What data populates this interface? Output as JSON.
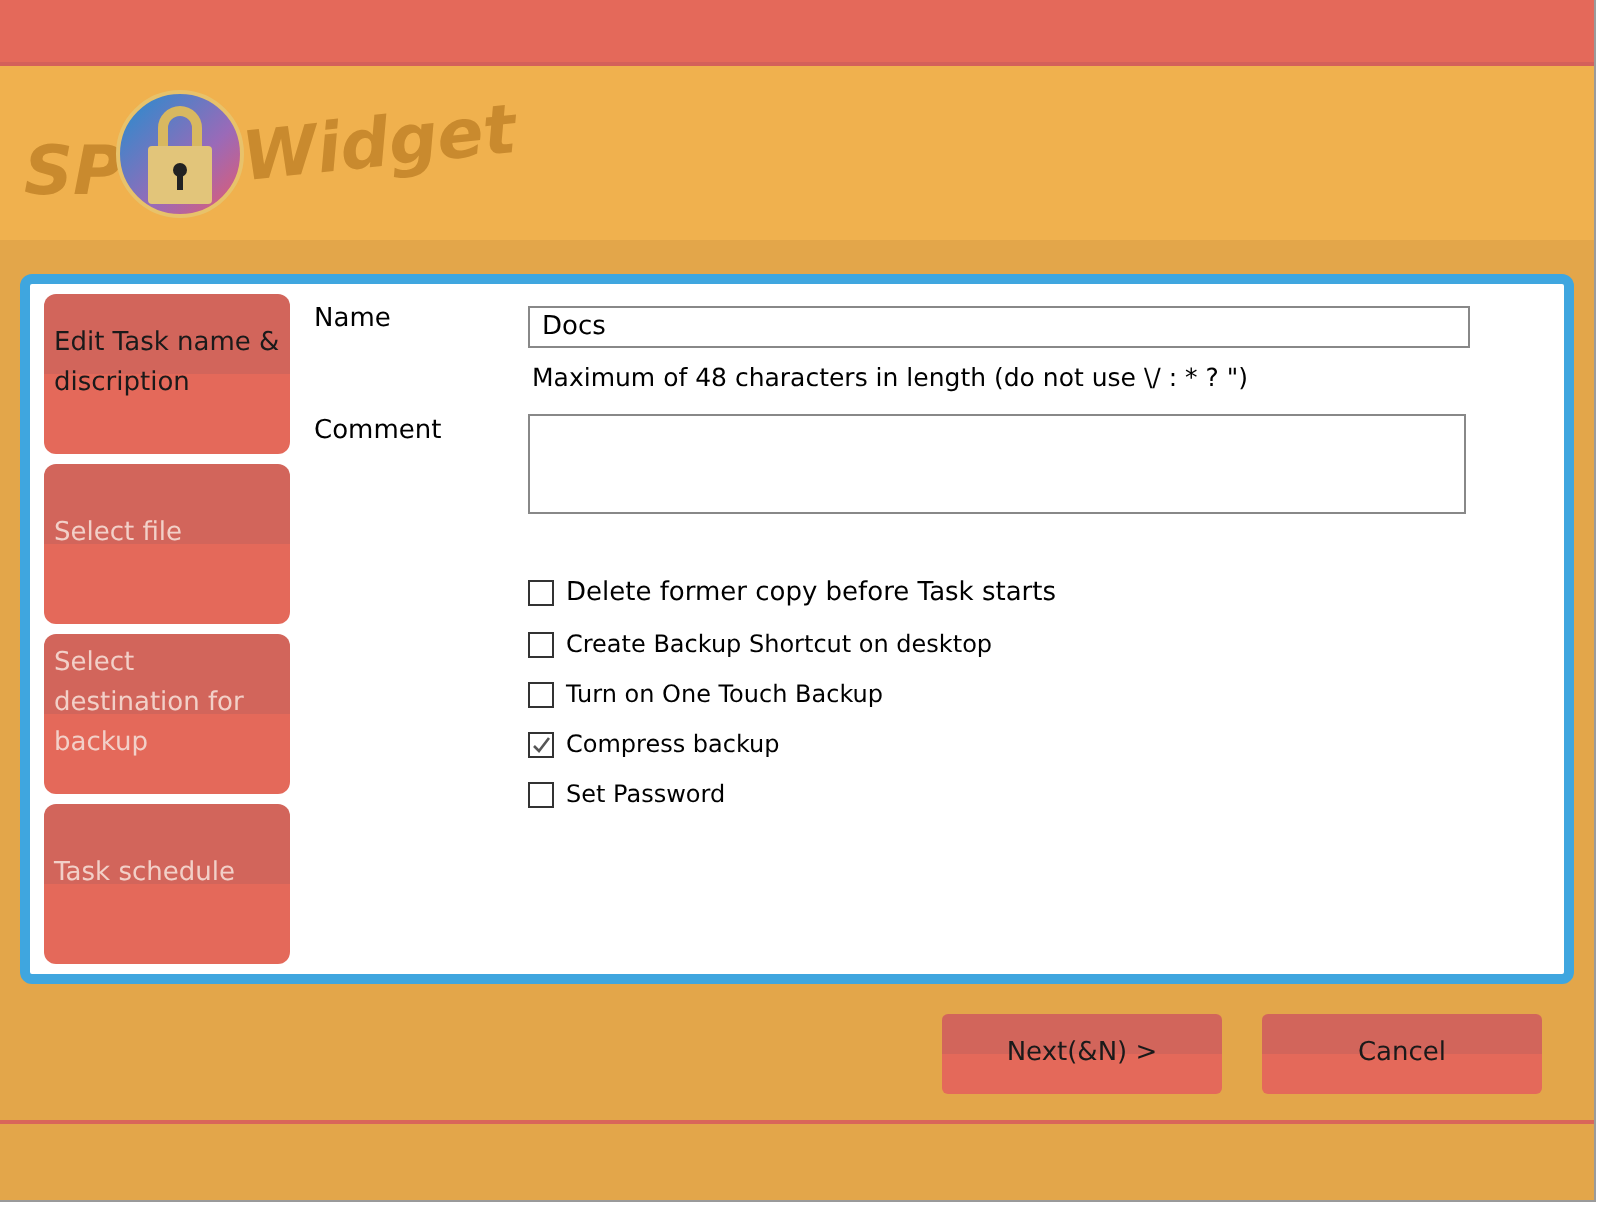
{
  "logo": {
    "text_left": "SP",
    "text_right": "Widget"
  },
  "steps": [
    {
      "label": "Edit Task name & discription",
      "selected": true
    },
    {
      "label": "Select file",
      "selected": false
    },
    {
      "label": "Select destination for backup",
      "selected": false
    },
    {
      "label": "Task schedule",
      "selected": false
    }
  ],
  "form": {
    "name_label": "Name",
    "name_value": "Docs",
    "hint": "Maximum of 48 characters in length (do not use \\/ : * ? \")",
    "comment_label": "Comment"
  },
  "options": [
    {
      "label": "Delete former copy before Task starts",
      "checked": false
    },
    {
      "label": "Create Backup Shortcut on desktop",
      "checked": false
    },
    {
      "label": "Turn on One Touch Backup",
      "checked": false
    },
    {
      "label": "Compress backup",
      "checked": true
    },
    {
      "label": "Set Password",
      "checked": false
    }
  ],
  "buttons": [
    "Next(&N) >",
    "Cancel"
  ]
}
